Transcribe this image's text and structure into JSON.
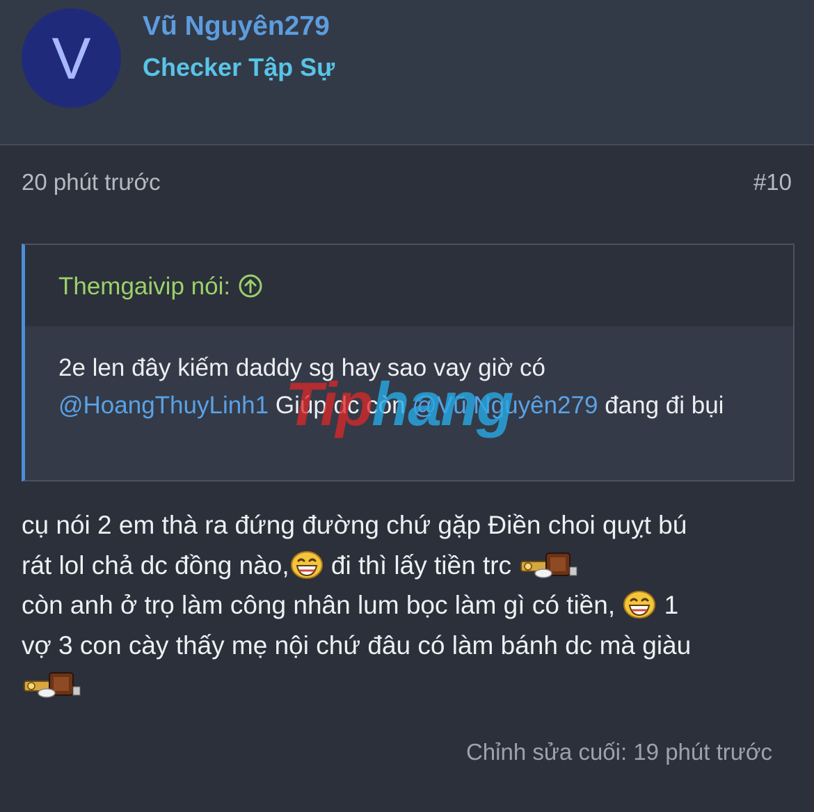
{
  "user": {
    "avatar_letter": "V",
    "name": "Vũ Nguyên279",
    "title": "Checker Tập Sự"
  },
  "post_meta": {
    "time": "20 phút trước",
    "number": "#10"
  },
  "quote": {
    "author_label": "Themgaivip nói:",
    "text_1": "2e len đây kiếm daddy sg hay sao vay giờ có",
    "mention_1": "@HoangThuyLinh1",
    "text_2": " Giúp dc còn ",
    "mention_2": "@Vũ Nguyên279",
    "text_3": " đang đi bụi"
  },
  "watermark": {
    "part1": "Tip",
    "part2": "hang"
  },
  "post": {
    "line1": "cụ nói 2 em thà ra đứng đường chứ gặp Điền choi quỵt bú",
    "line2a": "rát lol chả dc đồng nào,",
    "line2b": " đi thì lấy tiền trc ",
    "line3a": "còn anh ở trọ làm công nhân lum bọc làm gì có tiền, ",
    "line3b": " 1",
    "line4": "vợ 3 con cày thấy mẹ nội chứ đâu có làm bánh dc mà giàu"
  },
  "footer": {
    "edited": "Chỉnh sửa cuối: 19 phút trước"
  },
  "icons": {
    "quote_arrow": "arrow-up-circle-icon",
    "laughing": "laughing-emoji-icon",
    "money": "money-smilie-icon"
  },
  "colors": {
    "background": "#2b303a",
    "header_bg": "#333a47",
    "username": "#5c9de0",
    "user_title": "#58c4e8",
    "quote_author": "#9bd16b",
    "mention": "#5aa2e6",
    "quote_border": "#4a8fd8"
  }
}
